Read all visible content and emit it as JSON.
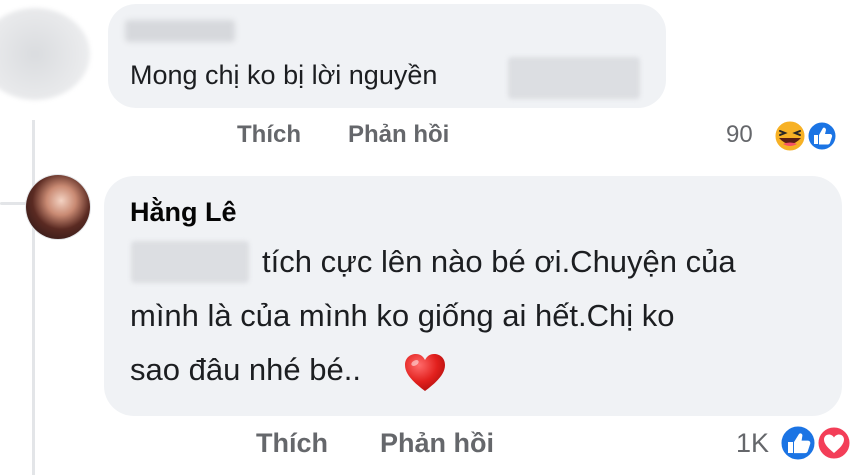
{
  "comment1": {
    "text": "Mong chị ko bị lời nguyền",
    "actions": {
      "like": "Thích",
      "reply": "Phản hồi"
    },
    "reaction_count": "90",
    "reactions": [
      "haha-icon",
      "like-icon"
    ]
  },
  "comment2": {
    "author": "Hằng Lê",
    "line1": "tích cực lên nào bé ơi.Chuyện của",
    "line2": "mình là của mình ko giống ai hết.Chị ko",
    "line3": "sao đâu nhé bé..",
    "actions": {
      "like": "Thích",
      "reply": "Phản hồi"
    },
    "reaction_count": "1K",
    "reactions": [
      "like-icon",
      "love-icon"
    ]
  },
  "colors": {
    "bubble": "#f0f2f5",
    "secondary_text": "#65676b",
    "like_blue": "#1b74e4",
    "love_red": "#f33e58",
    "haha_yellow": "#f7b125"
  }
}
